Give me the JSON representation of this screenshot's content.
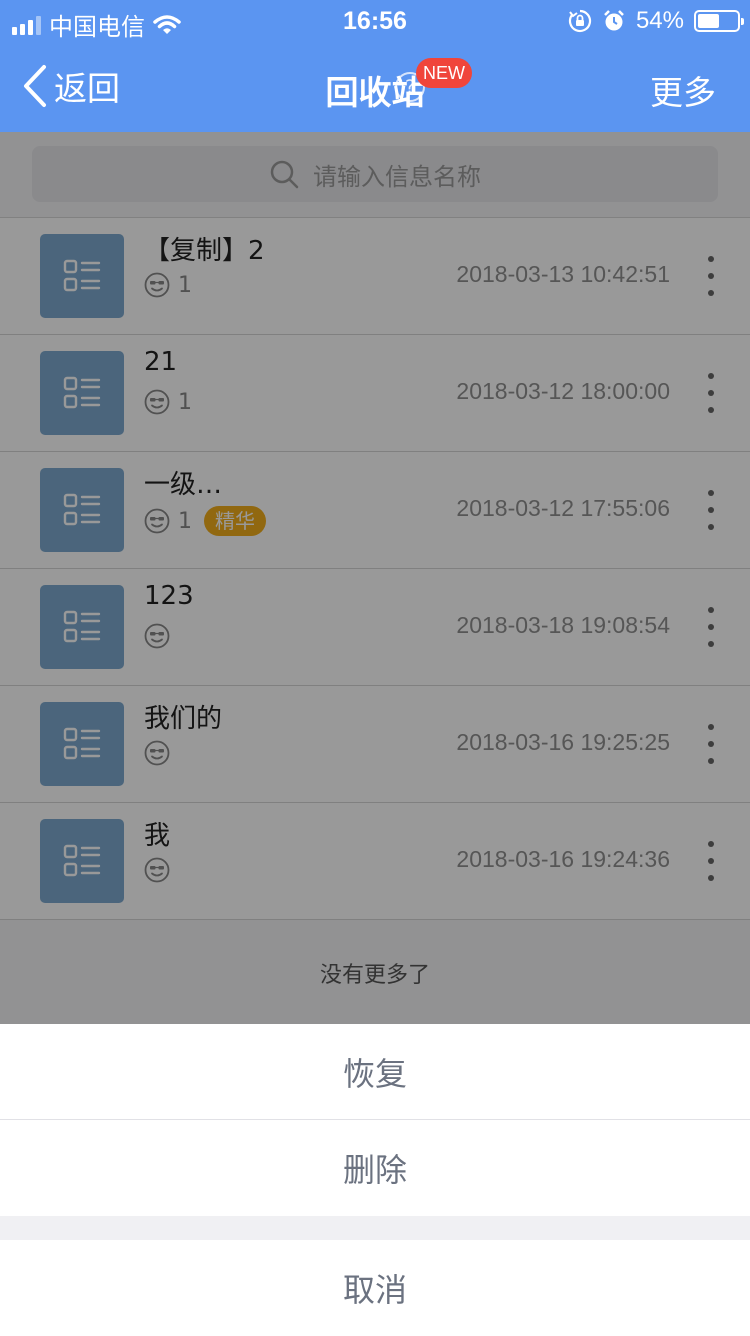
{
  "status_bar": {
    "carrier": "中国电信",
    "time": "16:56",
    "battery_percent_text": "54%",
    "battery_level": 0.54
  },
  "nav": {
    "back_label": "返回",
    "title": "回收站",
    "help_glyph": "?",
    "new_badge": "NEW",
    "more_label": "更多"
  },
  "search": {
    "placeholder": "请输入信息名称"
  },
  "items": [
    {
      "title": "【复制】2",
      "count": "1",
      "badge": "",
      "time": "2018-03-13 10:42:51"
    },
    {
      "title": "21",
      "count": "1",
      "badge": "",
      "time": "2018-03-12 18:00:00"
    },
    {
      "title": "一级…",
      "count": "1",
      "badge": "精华",
      "time": "2018-03-12 17:55:06"
    },
    {
      "title": "123",
      "count": "",
      "badge": "",
      "time": "2018-03-18 19:08:54"
    },
    {
      "title": "我们的",
      "count": "",
      "badge": "",
      "time": "2018-03-16 19:25:25"
    },
    {
      "title": "我",
      "count": "",
      "badge": "",
      "time": "2018-03-16 19:24:36"
    }
  ],
  "list_end_text": "没有更多了",
  "action_sheet": {
    "restore_label": "恢复",
    "delete_label": "删除",
    "cancel_label": "取消"
  },
  "colors": {
    "header_blue": "#5b95f1",
    "thumb_blue": "#7da9cf",
    "new_badge_red": "#f0453b",
    "jinghua_gold": "#f2ae1c"
  },
  "icons": {
    "thumb": "list-doc-icon",
    "meta": "smiley-face-icon",
    "menu": "more-vertical-icon"
  }
}
